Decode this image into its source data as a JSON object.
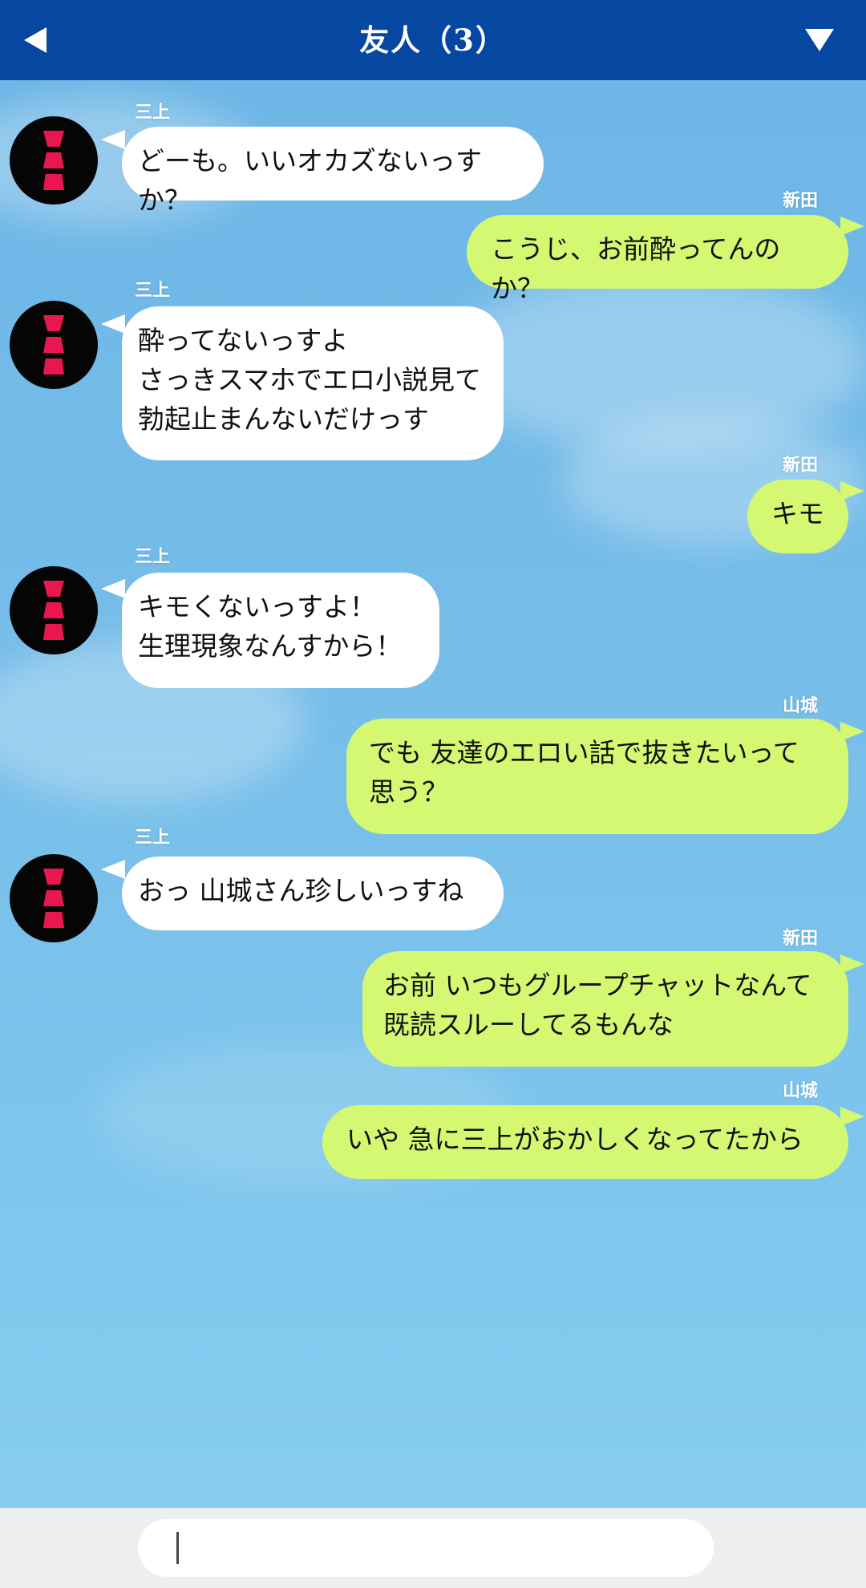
{
  "header": {
    "title": "友人（3）"
  },
  "messages": [
    {
      "side": "left",
      "sender": "三上",
      "text": "どーも。いいオカズないっすか？"
    },
    {
      "side": "right",
      "sender": "新田",
      "text": "こうじ、お前酔ってんのか？"
    },
    {
      "side": "left",
      "sender": "三上",
      "text": "酔ってないっすよ\nさっきスマホでエロ小説見て\n勃起止まんないだけっす"
    },
    {
      "side": "right",
      "sender": "新田",
      "text": "キモ"
    },
    {
      "side": "left",
      "sender": "三上",
      "text": "キモくないっすよ！\n生理現象なんすから！"
    },
    {
      "side": "right",
      "sender": "山城",
      "text": "でも 友達のエロい話で抜きたいって\n思う？"
    },
    {
      "side": "left",
      "sender": "三上",
      "text": "おっ 山城さん珍しいっすね"
    },
    {
      "side": "right",
      "sender": "新田",
      "text": "お前 いつもグループチャットなんて\n既読スルーしてるもんな"
    },
    {
      "side": "right",
      "sender": "山城",
      "text": "いや 急に三上がおかしくなってたから"
    }
  ],
  "input": {
    "value": ""
  },
  "colors": {
    "header": "#0547a1",
    "bubble_left": "#ffffff",
    "bubble_right": "#d4f872",
    "avatar": "#050505",
    "avatar_mark": "#e8174f"
  },
  "icons": {
    "back": "back-triangle-icon",
    "menu": "dropdown-triangle-icon"
  }
}
